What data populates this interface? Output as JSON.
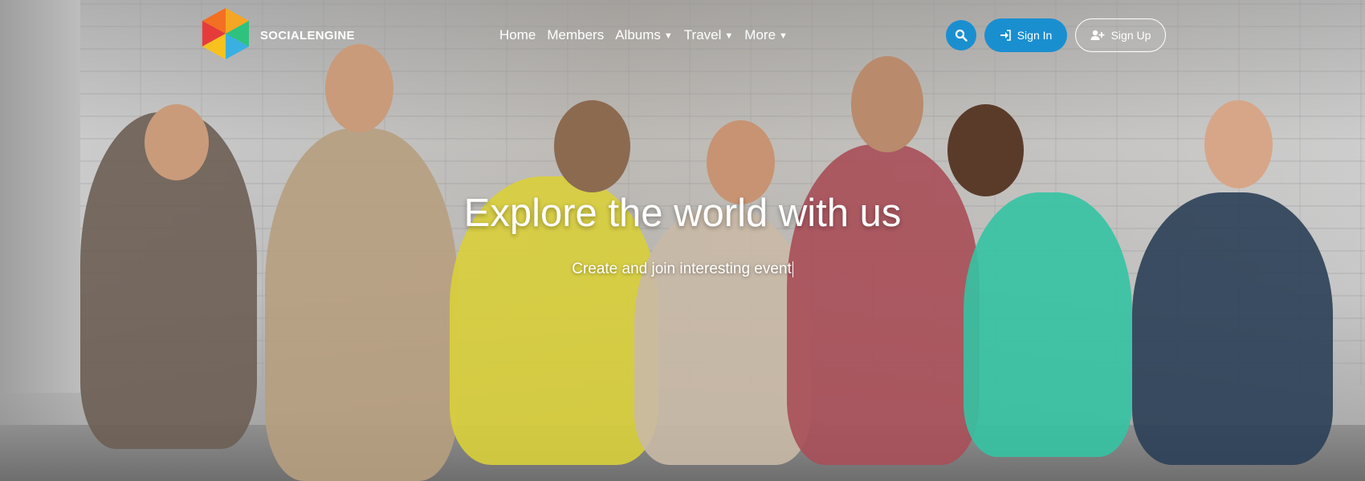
{
  "brand": {
    "name": "SOCIALENGINE"
  },
  "nav": {
    "items": [
      {
        "label": "Home",
        "dropdown": false
      },
      {
        "label": "Members",
        "dropdown": false
      },
      {
        "label": "Albums",
        "dropdown": true
      },
      {
        "label": "Travel",
        "dropdown": true
      },
      {
        "label": "More",
        "dropdown": true
      }
    ]
  },
  "actions": {
    "search_icon": "search-icon",
    "signin_label": "Sign In",
    "signup_label": "Sign Up"
  },
  "hero": {
    "title": "Explore the world with us",
    "subtitle": "Create and join interesting event"
  },
  "colors": {
    "accent": "#1a8fd0",
    "text": "#ffffff"
  }
}
